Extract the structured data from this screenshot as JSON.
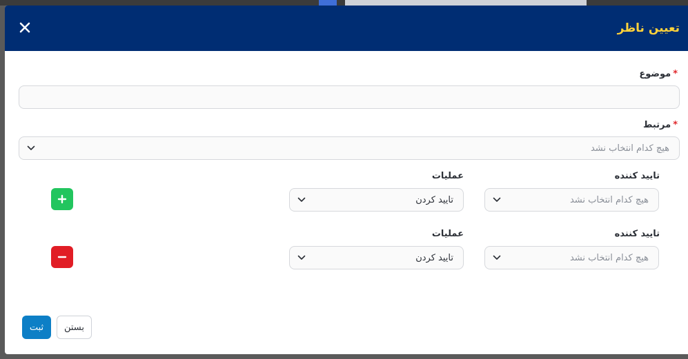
{
  "modal": {
    "title": "تعیین ناظر",
    "close_icon": "close-icon"
  },
  "form": {
    "subject": {
      "label": "موضوع",
      "required_mark": "*",
      "value": ""
    },
    "related": {
      "label": "مرتبط",
      "required_mark": "*",
      "placeholder": "هیچ کدام انتخاب نشد"
    },
    "rows": [
      {
        "approver_label": "تایید کننده",
        "approver_placeholder": "هیچ کدام انتخاب نشد",
        "operations_label": "عملیات",
        "operations_value": "تایید کردن",
        "action": "add"
      },
      {
        "approver_label": "تایید کننده",
        "approver_placeholder": "هیچ کدام انتخاب نشد",
        "operations_label": "عملیات",
        "operations_value": "تایید کردن",
        "action": "remove"
      }
    ]
  },
  "footer": {
    "submit_label": "ثبت",
    "close_label": "بستن"
  },
  "colors": {
    "header_bg": "#002d73",
    "title": "#ffd23a",
    "submit": "#0d7fc6",
    "add": "#22c55e",
    "remove": "#e11d25",
    "required": "#e0292d"
  }
}
